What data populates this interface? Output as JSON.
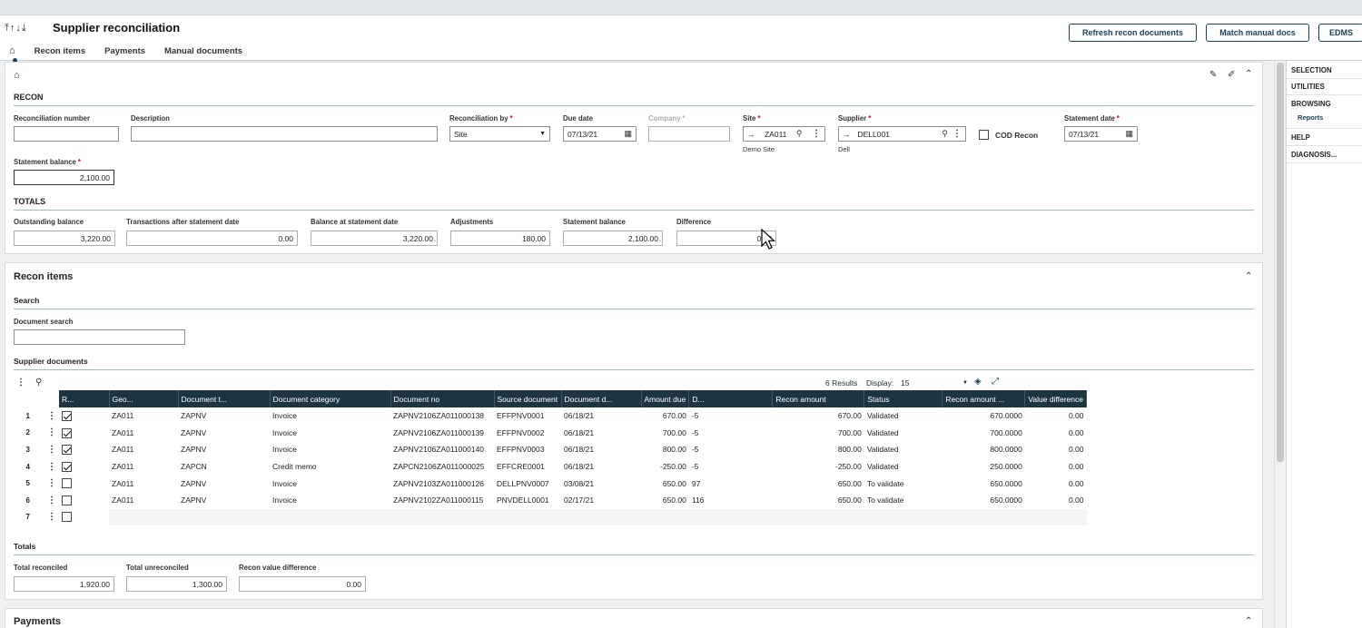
{
  "header": {
    "title": "Supplier reconciliation",
    "nav_arrows": "⤒↑↓⤓",
    "buttons": {
      "refresh": "Refresh recon documents",
      "match": "Match manual docs",
      "edms": "EDMS"
    },
    "tabs": [
      "Recon items",
      "Payments",
      "Manual documents"
    ]
  },
  "recon": {
    "section_title": "RECON",
    "reconciliation_number": {
      "label": "Reconciliation number",
      "value": ""
    },
    "description": {
      "label": "Description",
      "value": ""
    },
    "reconciliation_by": {
      "label": "Reconciliation by",
      "value": "Site"
    },
    "due_date": {
      "label": "Due date",
      "value": "07/13/21"
    },
    "company": {
      "label": "Company",
      "value": ""
    },
    "site": {
      "label": "Site",
      "value": "ZA011",
      "subtext": "Demo Site"
    },
    "supplier": {
      "label": "Supplier",
      "value": "DELL001",
      "subtext": "Dell"
    },
    "cod_recon": {
      "label": "COD Recon",
      "checked": false
    },
    "statement_date": {
      "label": "Statement date",
      "value": "07/13/21"
    },
    "statement_balance": {
      "label": "Statement balance",
      "value": "2,100.00"
    }
  },
  "totals": {
    "section_title": "TOTALS",
    "outstanding_balance": {
      "label": "Outstanding balance",
      "value": "3,220.00"
    },
    "transactions_after": {
      "label": "Transactions after statement date",
      "value": "0.00"
    },
    "balance_at_statement": {
      "label": "Balance at statement date",
      "value": "3,220.00"
    },
    "adjustments": {
      "label": "Adjustments",
      "value": "180.00"
    },
    "statement_balance": {
      "label": "Statement balance",
      "value": "2,100.00"
    },
    "difference": {
      "label": "Difference",
      "value": "0.00"
    }
  },
  "recon_items": {
    "title": "Recon items",
    "search_title": "Search",
    "document_search": {
      "label": "Document search",
      "value": ""
    },
    "supplier_documents_title": "Supplier documents",
    "results_text": "6 Results",
    "display_label": "Display:",
    "display_value": "15",
    "columns": [
      "R...",
      "Geo...",
      "Document t...",
      "Document category",
      "Document no",
      "Source document",
      "Document d...",
      "Amount due",
      "D...",
      "Recon amount",
      "Status",
      "Recon amount ...",
      "Value difference"
    ],
    "rows": [
      {
        "num": "1",
        "checked": true,
        "geo": "ZA011",
        "type": "ZAPNV",
        "category": "Invoice",
        "doc_no": "ZAPNV2106ZA011000138",
        "source": "EFFPNV0001",
        "date": "06/18/21",
        "amount_due": "670.00",
        "d": "-5",
        "recon_amount": "670.00",
        "status": "Validated",
        "recon_amount2": "670.0000",
        "value_diff": "0.00"
      },
      {
        "num": "2",
        "checked": true,
        "geo": "ZA011",
        "type": "ZAPNV",
        "category": "Invoice",
        "doc_no": "ZAPNV2106ZA011000139",
        "source": "EFFPNV0002",
        "date": "06/18/21",
        "amount_due": "700.00",
        "d": "-5",
        "recon_amount": "700.00",
        "status": "Validated",
        "recon_amount2": "700.0000",
        "value_diff": "0.00"
      },
      {
        "num": "3",
        "checked": true,
        "geo": "ZA011",
        "type": "ZAPNV",
        "category": "Invoice",
        "doc_no": "ZAPNV2106ZA011000140",
        "source": "EFFPNV0003",
        "date": "06/18/21",
        "amount_due": "800.00",
        "d": "-5",
        "recon_amount": "800.00",
        "status": "Validated",
        "recon_amount2": "800.0000",
        "value_diff": "0.00"
      },
      {
        "num": "4",
        "checked": true,
        "geo": "ZA011",
        "type": "ZAPCN",
        "category": "Credit memo",
        "doc_no": "ZAPCN2106ZA011000025",
        "source": "EFFCRE0001",
        "date": "06/18/21",
        "amount_due": "-250.00",
        "d": "-5",
        "recon_amount": "-250.00",
        "status": "Validated",
        "recon_amount2": "250.0000",
        "value_diff": "0.00"
      },
      {
        "num": "5",
        "checked": false,
        "geo": "ZA011",
        "type": "ZAPNV",
        "category": "Invoice",
        "doc_no": "ZAPNV2103ZA011000126",
        "source": "DELLPNV0007",
        "date": "03/08/21",
        "amount_due": "650.00",
        "d": "97",
        "recon_amount": "650.00",
        "status": "To validate",
        "recon_amount2": "650.0000",
        "value_diff": "0.00"
      },
      {
        "num": "6",
        "checked": false,
        "geo": "ZA011",
        "type": "ZAPNV",
        "category": "Invoice",
        "doc_no": "ZAPNV2102ZA011000115",
        "source": "PNVDELL0001",
        "date": "02/17/21",
        "amount_due": "650.00",
        "d": "116",
        "recon_amount": "650.00",
        "status": "To validate",
        "recon_amount2": "650.0000",
        "value_diff": "0.00"
      },
      {
        "num": "7",
        "checked": false,
        "geo": "",
        "type": "",
        "category": "",
        "doc_no": "",
        "source": "",
        "date": "",
        "amount_due": "",
        "d": "",
        "recon_amount": "",
        "status": "",
        "recon_amount2": "",
        "value_diff": ""
      }
    ],
    "totals_title": "Totals",
    "total_reconciled": {
      "label": "Total reconciled",
      "value": "1,920.00"
    },
    "total_unreconciled": {
      "label": "Total unreconciled",
      "value": "1,300.00"
    },
    "recon_value_difference": {
      "label": "Recon value difference",
      "value": "0.00"
    }
  },
  "payments": {
    "title": "Payments"
  },
  "right_panel": {
    "selection": "SELECTION",
    "utilities": "UTILITIES",
    "browsing": "BROWSING",
    "reports": "Reports",
    "help": "HELP",
    "diagnosis": "DIAGNOSIS..."
  },
  "colors": {
    "accent": "#17425c",
    "table_header": "#1d3540",
    "required": "#d0021b",
    "section_line": "#9fb8c6"
  }
}
